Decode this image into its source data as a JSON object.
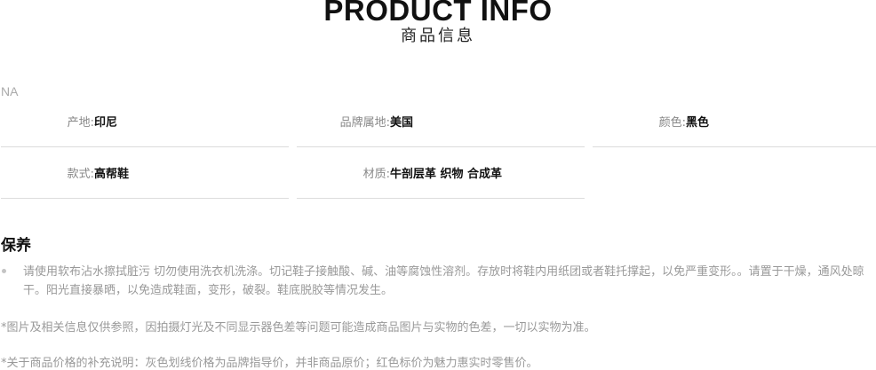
{
  "header": {
    "title": "PRODUCT INFO",
    "subtitle": "商品信息"
  },
  "brand": "NA",
  "attributes": [
    {
      "label": "产地:",
      "value": "印尼"
    },
    {
      "label": "品牌属地:",
      "value": "美国"
    },
    {
      "label": "颜色:",
      "value": "黑色"
    },
    {
      "label": "款式:",
      "value": "高帮鞋"
    },
    {
      "label": "材质:",
      "value": "牛剖层革 织物 合成革"
    }
  ],
  "care": {
    "title": "保养",
    "items": [
      "请使用软布沾水擦拭脏污 切勿使用洗衣机洗涤。切记鞋子接触酸、碱、油等腐蚀性溶剂。存放时将鞋内用纸团或者鞋托撑起，以免严重变形。。请置于干燥，通风处晾干。阳光直接暴晒，以免造成鞋面，变形，破裂。鞋底脱胶等情况发生。"
    ]
  },
  "notes": {
    "disclaimer": "*图片及相关信息仅供参照，因拍摄灯光及不同显示器色差等问题可能造成商品图片与实物的色差，一切以实物为准。",
    "price": "*关于商品价格的补充说明：灰色划线价格为品牌指导价，并非商品原价；红色标价为魅力惠实时零售价。"
  }
}
